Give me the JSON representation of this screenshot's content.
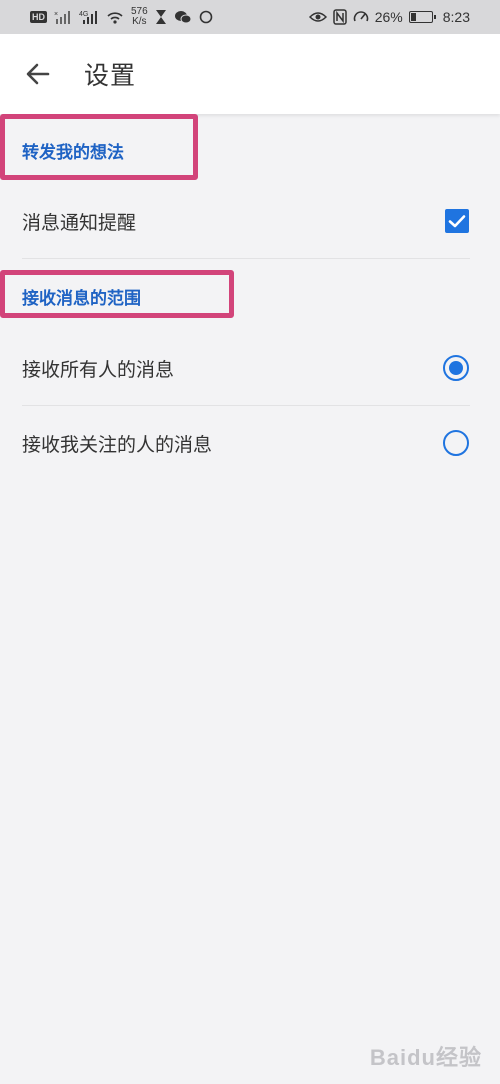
{
  "status_bar": {
    "net_speed_value": "576",
    "net_speed_unit": "K/s",
    "battery": "26%",
    "time": "8:23",
    "battery_level": 0.26,
    "icons": [
      "hd-icon",
      "signal-x-icon",
      "signal-4g-icon",
      "wifi-icon",
      "hourglass-icon",
      "wechat-icon",
      "circle-icon",
      "eye-icon",
      "nfc-icon",
      "speed-icon",
      "battery-icon"
    ]
  },
  "app_bar": {
    "title": "设置",
    "back_icon": "back-arrow-icon"
  },
  "sections": [
    {
      "header": "转发我的想法",
      "items": [
        {
          "label": "消息通知提醒",
          "control": "checkbox",
          "checked": true
        }
      ]
    },
    {
      "header": "接收消息的范围",
      "items": [
        {
          "label": "接收所有人的消息",
          "control": "radio",
          "selected": true
        },
        {
          "label": "接收我关注的人的消息",
          "control": "radio",
          "selected": false
        }
      ]
    }
  ],
  "watermark": "Baidu经验",
  "colors": {
    "accent": "#1f74e0",
    "section_header": "#1f63c4",
    "highlight_box": "#d2447a",
    "background": "#f3f3f5"
  }
}
